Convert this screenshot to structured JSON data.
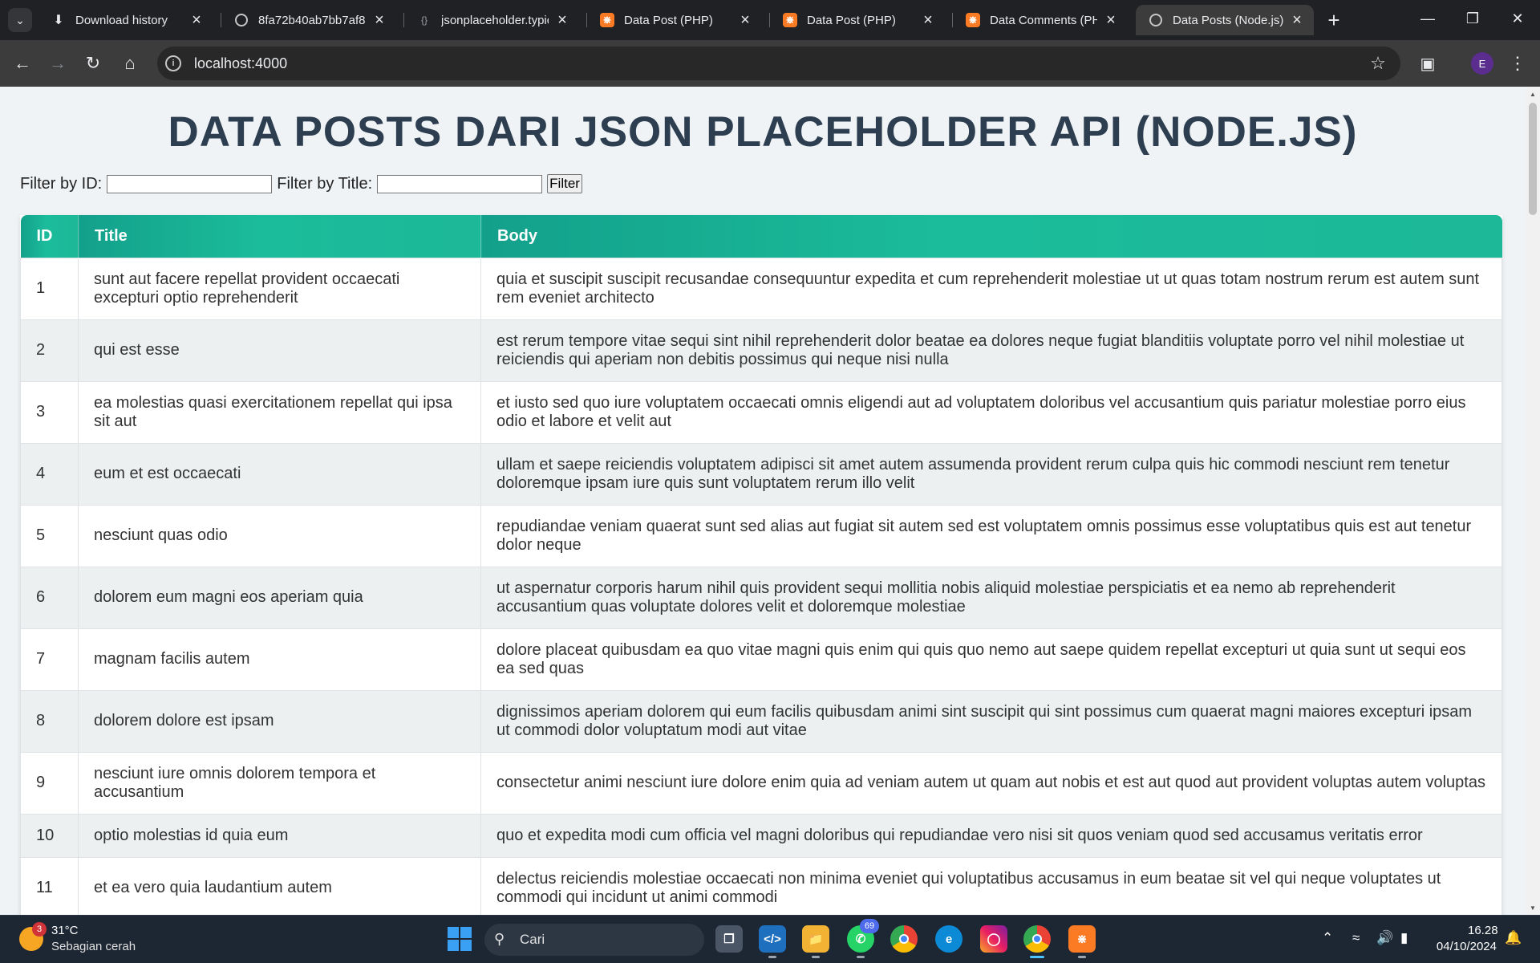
{
  "browser": {
    "tabs": [
      {
        "title": "Download history",
        "icon": "download-icon",
        "active": false
      },
      {
        "title": "8fa72b40ab7bb7af8",
        "icon": "globe-icon",
        "active": false
      },
      {
        "title": "jsonplaceholder.typic",
        "icon": "jsonplaceholder-icon",
        "active": false
      },
      {
        "title": "Data Post (PHP)",
        "icon": "xampp-icon",
        "active": false
      },
      {
        "title": "Data Post (PHP)",
        "icon": "xampp-icon",
        "active": false
      },
      {
        "title": "Data Comments (PHI",
        "icon": "xampp-icon",
        "active": false
      },
      {
        "title": "Data Posts (Node.js)",
        "icon": "globe-icon",
        "active": true
      }
    ],
    "url": "localhost:4000",
    "profile_initial": "E"
  },
  "page": {
    "title": "DATA POSTS DARI JSON PLACEHOLDER API (NODE.JS)",
    "filter": {
      "id_label": "Filter by ID:",
      "title_label": "Filter by Title:",
      "id_value": "",
      "title_value": "",
      "button_label": "Filter"
    },
    "table": {
      "headers": [
        "ID",
        "Title",
        "Body"
      ],
      "rows": [
        {
          "id": "1",
          "title": "sunt aut facere repellat provident occaecati excepturi optio reprehenderit",
          "body": "quia et suscipit suscipit recusandae consequuntur expedita et cum reprehenderit molestiae ut ut quas totam nostrum rerum est autem sunt rem eveniet architecto"
        },
        {
          "id": "2",
          "title": "qui est esse",
          "body": "est rerum tempore vitae sequi sint nihil reprehenderit dolor beatae ea dolores neque fugiat blanditiis voluptate porro vel nihil molestiae ut reiciendis qui aperiam non debitis possimus qui neque nisi nulla"
        },
        {
          "id": "3",
          "title": "ea molestias quasi exercitationem repellat qui ipsa sit aut",
          "body": "et iusto sed quo iure voluptatem occaecati omnis eligendi aut ad voluptatem doloribus vel accusantium quis pariatur molestiae porro eius odio et labore et velit aut"
        },
        {
          "id": "4",
          "title": "eum et est occaecati",
          "body": "ullam et saepe reiciendis voluptatem adipisci sit amet autem assumenda provident rerum culpa quis hic commodi nesciunt rem tenetur doloremque ipsam iure quis sunt voluptatem rerum illo velit"
        },
        {
          "id": "5",
          "title": "nesciunt quas odio",
          "body": "repudiandae veniam quaerat sunt sed alias aut fugiat sit autem sed est voluptatem omnis possimus esse voluptatibus quis est aut tenetur dolor neque"
        },
        {
          "id": "6",
          "title": "dolorem eum magni eos aperiam quia",
          "body": "ut aspernatur corporis harum nihil quis provident sequi mollitia nobis aliquid molestiae perspiciatis et ea nemo ab reprehenderit accusantium quas voluptate dolores velit et doloremque molestiae"
        },
        {
          "id": "7",
          "title": "magnam facilis autem",
          "body": "dolore placeat quibusdam ea quo vitae magni quis enim qui quis quo nemo aut saepe quidem repellat excepturi ut quia sunt ut sequi eos ea sed quas"
        },
        {
          "id": "8",
          "title": "dolorem dolore est ipsam",
          "body": "dignissimos aperiam dolorem qui eum facilis quibusdam animi sint suscipit qui sint possimus cum quaerat magni maiores excepturi ipsam ut commodi dolor voluptatum modi aut vitae"
        },
        {
          "id": "9",
          "title": "nesciunt iure omnis dolorem tempora et accusantium",
          "body": "consectetur animi nesciunt iure dolore enim quia ad veniam autem ut quam aut nobis et est aut quod aut provident voluptas autem voluptas"
        },
        {
          "id": "10",
          "title": "optio molestias id quia eum",
          "body": "quo et expedita modi cum officia vel magni doloribus qui repudiandae vero nisi sit quos veniam quod sed accusamus veritatis error"
        },
        {
          "id": "11",
          "title": "et ea vero quia laudantium autem",
          "body": "delectus reiciendis molestiae occaecati non minima eveniet qui voluptatibus accusamus in eum beatae sit vel qui neque voluptates ut commodi qui incidunt ut animi commodi"
        }
      ]
    }
  },
  "taskbar": {
    "weather_temp": "31°C",
    "weather_desc": "Sebagian cerah",
    "weather_badge": "3",
    "search_label": "Cari",
    "whatsapp_badge": "69",
    "time": "16.28",
    "date": "04/10/2024"
  },
  "colors": {
    "header_teal": "#1abc9c",
    "title_navy": "#2c3e50",
    "row_alt": "#ecf0f1"
  }
}
